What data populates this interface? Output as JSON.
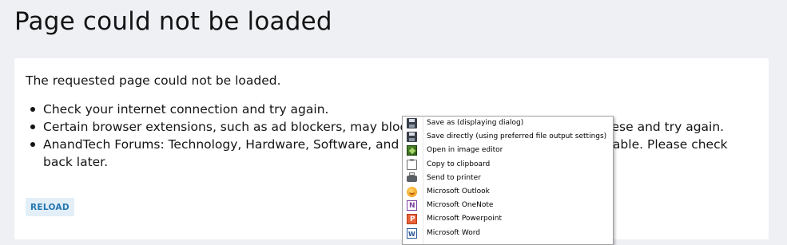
{
  "page": {
    "title": "Page could not be loaded"
  },
  "panel": {
    "intro": "The requested page could not be loaded.",
    "reasons": [
      "Check your internet connection and try again.",
      "Certain browser extensions, such as ad blockers, may block pages unexpectedly. Disable these and try again.",
      "AnandTech Forums: Technology, Hardware, Software, and Deals may be temporarily unavailable. Please check back later."
    ],
    "reload_label": "RELOAD"
  },
  "context_menu": {
    "items": [
      {
        "label": "Save as (displaying dialog)",
        "icon": "save-floppy-icon"
      },
      {
        "label": "Save directly (using preferred file output settings)",
        "icon": "save-floppy-icon"
      },
      {
        "label": "Open in image editor",
        "icon": "image-editor-icon"
      },
      {
        "label": "Copy to clipboard",
        "icon": "clipboard-icon"
      },
      {
        "label": "Send to printer",
        "icon": "printer-icon"
      },
      {
        "label": "Microsoft Outlook",
        "icon": "outlook-icon"
      },
      {
        "label": "Microsoft OneNote",
        "icon": "onenote-icon"
      },
      {
        "label": "Microsoft Powerpoint",
        "icon": "powerpoint-icon"
      },
      {
        "label": "Microsoft Word",
        "icon": "word-icon"
      }
    ]
  },
  "colors": {
    "page_background": "#eef0f3",
    "panel_background": "#ffffff",
    "reload_text": "#2577b1",
    "reload_background": "#e3eff8"
  }
}
